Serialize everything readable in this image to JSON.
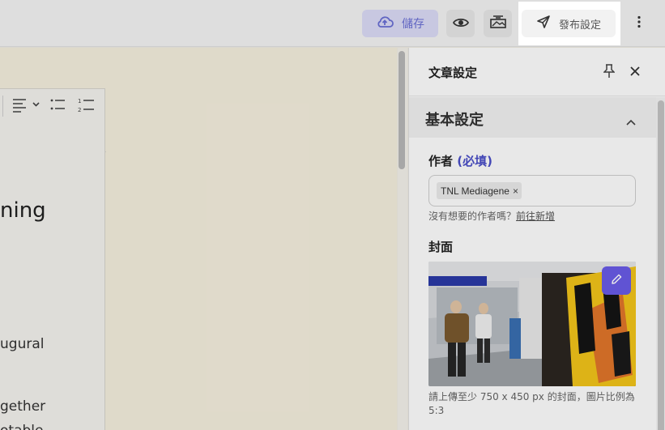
{
  "toolbar": {
    "save_label": "儲存",
    "publish_label": "發布設定"
  },
  "editor": {
    "heading_fragment": "ning",
    "line1_fragment": "ugural",
    "line2_fragment": "gether",
    "line3_fragment": "otable"
  },
  "panel": {
    "title": "文章設定",
    "section_title": "基本設定",
    "author_label": "作者",
    "author_required": "(必填)",
    "author_chip": "TNL Mediagene",
    "author_chip_remove": "×",
    "author_hint": "沒有想要的作者嗎？",
    "author_hint_link": "前往新增",
    "cover_label": "封面",
    "cover_hint": "請上傳至少 750 x 450 px 的封面，圖片比例為 5:3"
  },
  "colors": {
    "accent": "#6a5ce8",
    "save_bg": "#dcdcf8",
    "required": "#4a4fc9"
  }
}
